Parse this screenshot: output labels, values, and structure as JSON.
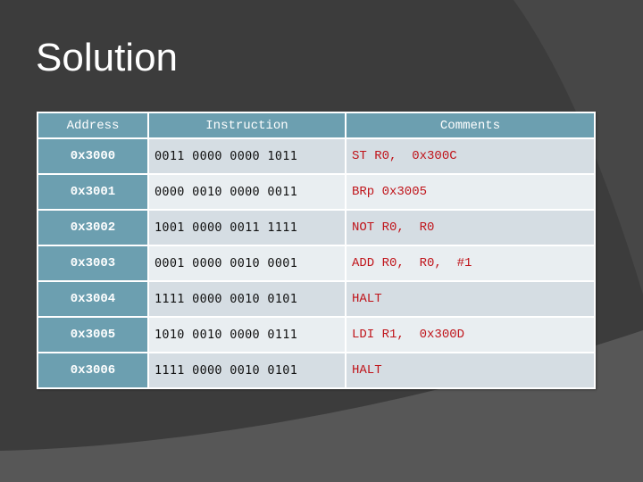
{
  "slide": {
    "title": "Solution"
  },
  "table": {
    "headers": {
      "address": "Address",
      "instruction": "Instruction",
      "comments": "Comments"
    },
    "rows": [
      {
        "address": "0x3000",
        "instruction": "0011 0000 0000 1011",
        "comment": "ST R0,  0x300C"
      },
      {
        "address": "0x3001",
        "instruction": "0000 0010 0000 0011",
        "comment": "BRp 0x3005"
      },
      {
        "address": "0x3002",
        "instruction": "1001 0000 0011 1111",
        "comment": "NOT R0,  R0"
      },
      {
        "address": "0x3003",
        "instruction": "0001 0000 0010 0001",
        "comment": "ADD R0,  R0,  #1"
      },
      {
        "address": "0x3004",
        "instruction": "1111 0000 0010 0101",
        "comment": "HALT"
      },
      {
        "address": "0x3005",
        "instruction": "1010 0010 0000 0111",
        "comment": "LDI R1,  0x300D"
      },
      {
        "address": "0x3006",
        "instruction": "1111 0000 0010 0101",
        "comment": "HALT"
      }
    ]
  },
  "colors": {
    "background": "#3c3c3c",
    "header_fill": "#6c9fb0",
    "row_odd": "#d5dde3",
    "row_even": "#e9eef1",
    "comment_text": "#c0141a"
  }
}
